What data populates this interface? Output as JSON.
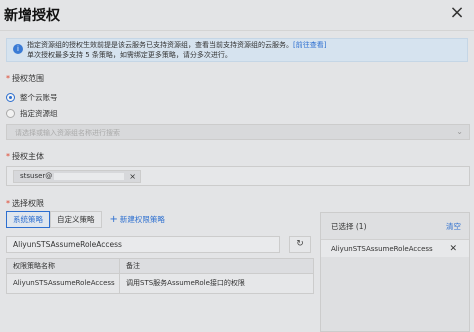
{
  "dialog": {
    "title": "新增授权",
    "close_glyph": "×"
  },
  "notice": {
    "icon": "info-icon",
    "line1_text": "指定资源组的授权生效前提是该云服务已支持资源组，查看当前支持资源组的云服务。",
    "line1_link": "[前往查看]",
    "line2_text": "单次授权最多支持 5 条策略，如需绑定更多策略，请分多次进行。"
  },
  "scope": {
    "label": "授权范围",
    "options": [
      {
        "label": "整个云账号",
        "checked": true
      },
      {
        "label": "指定资源组",
        "checked": false
      }
    ],
    "select_placeholder": "请选择或输入资源组名称进行搜索"
  },
  "principal": {
    "label": "授权主体",
    "tag_text": "stsuser@",
    "tag_close": "×"
  },
  "permissions": {
    "label": "选择权限",
    "tabs": [
      "系统策略",
      "自定义策略"
    ],
    "new_policy_label": "新建权限策略",
    "search_value": "AliyunSTSAssumeRoleAccess",
    "refresh_glyph": "↻",
    "table": {
      "headers": [
        "权限策略名称",
        "备注"
      ],
      "rows": [
        [
          "AliyunSTSAssumeRoleAccess",
          "调用STS服务AssumeRole接口的权限"
        ]
      ]
    }
  },
  "selected": {
    "header": "已选择 (1)",
    "clear_label": "清空",
    "items": [
      "AliyunSTSAssumeRoleAccess"
    ],
    "remove_glyph": "✕"
  },
  "colors": {
    "accent": "#2d6fd0",
    "required": "#e0462e"
  }
}
